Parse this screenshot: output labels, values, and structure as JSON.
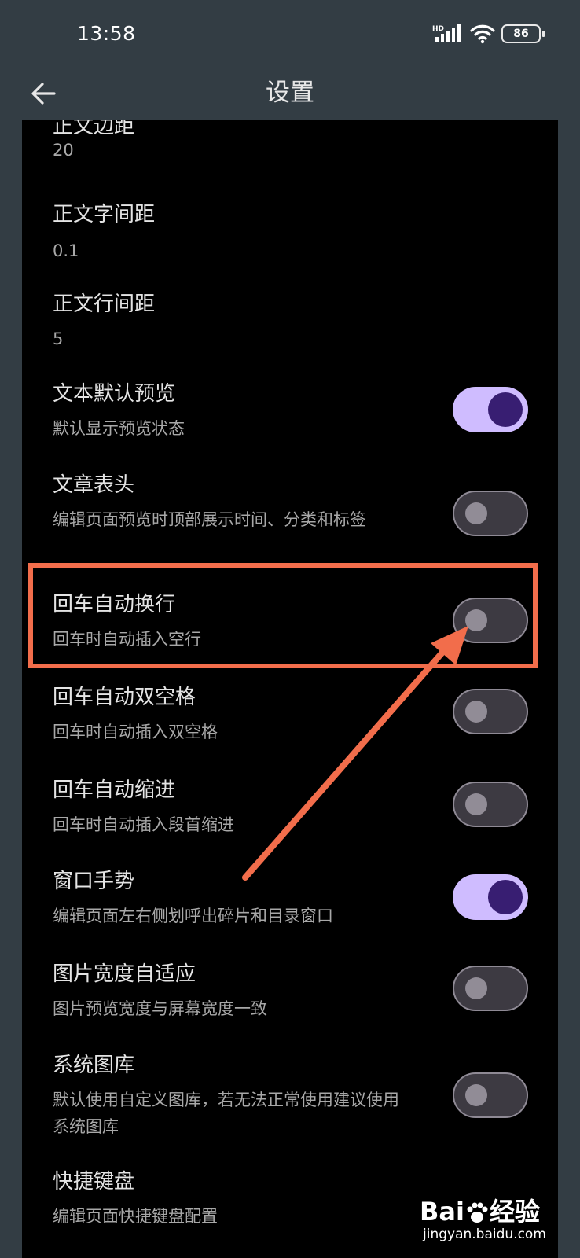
{
  "status_bar": {
    "time": "13:58",
    "network_label": "HD",
    "battery": "86",
    "icons": [
      "signal-icon",
      "wifi-icon",
      "battery-icon"
    ]
  },
  "app_bar": {
    "title": "设置",
    "back_icon": "arrow-left-icon"
  },
  "settings": [
    {
      "title": "正文边距",
      "value": "20"
    },
    {
      "title": "正文字间距",
      "value": "0.1"
    },
    {
      "title": "正文行间距",
      "value": "5"
    },
    {
      "title": "文本默认预览",
      "subtitle": "默认显示预览状态",
      "toggle": true
    },
    {
      "title": "文章表头",
      "subtitle": "编辑页面预览时顶部展示时间、分类和标签",
      "toggle": false
    },
    {
      "title": "回车自动换行",
      "subtitle": "回车时自动插入空行",
      "toggle": false
    },
    {
      "title": "回车自动双空格",
      "subtitle": "回车时自动插入双空格",
      "toggle": false
    },
    {
      "title": "回车自动缩进",
      "subtitle": "回车时自动插入段首缩进",
      "toggle": false
    },
    {
      "title": "窗口手势",
      "subtitle": "编辑页面左右侧划呼出碎片和目录窗口",
      "toggle": true
    },
    {
      "title": "图片宽度自适应",
      "subtitle": "图片预览宽度与屏幕宽度一致",
      "toggle": false
    },
    {
      "title": "系统图库",
      "subtitle": "默认使用自定义图库，若无法正常使用建议使用系统图库",
      "toggle": false
    },
    {
      "title": "快捷键盘",
      "subtitle": "编辑页面快捷键盘配置"
    }
  ],
  "colors": {
    "background": "#333d44",
    "panel": "#000000",
    "toggle_on_track": "#cfbcff",
    "toggle_on_knob": "#381e72",
    "toggle_off_track": "#3d3a42",
    "annotation": "#f26d4b"
  },
  "watermark": {
    "logo_left": "Bai",
    "logo_right": "经验",
    "url": "jingyan.baidu.com"
  }
}
